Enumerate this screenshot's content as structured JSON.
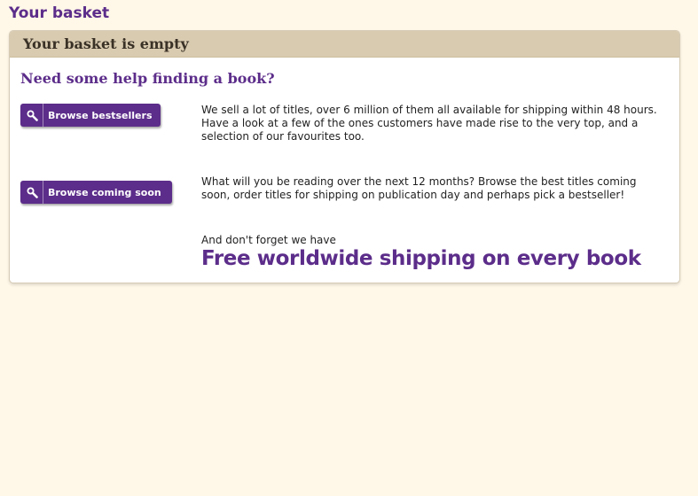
{
  "page": {
    "title": "Your basket"
  },
  "panel": {
    "header": "Your basket is empty",
    "help_heading": "Need some help finding a book?"
  },
  "actions": [
    {
      "label": "Browse bestsellers",
      "icon": "search-icon",
      "description": "We sell a lot of titles, over 6 million of them all available for shipping within 48 hours. Have a look at a few of the ones customers have made rise to the very top, and a selection of our favourites too."
    },
    {
      "label": "Browse coming soon",
      "icon": "search-icon",
      "description": "What will you be reading over the next 12 months? Browse the best titles coming soon, order titles for shipping on publication day and perhaps pick a bestseller!"
    }
  ],
  "shipping": {
    "intro": "And don't forget we have",
    "banner": "Free worldwide shipping on every book"
  },
  "colors": {
    "brand_purple": "#5c2d8a",
    "page_background": "#fff7e8",
    "panel_header": "#d9cbb0"
  }
}
